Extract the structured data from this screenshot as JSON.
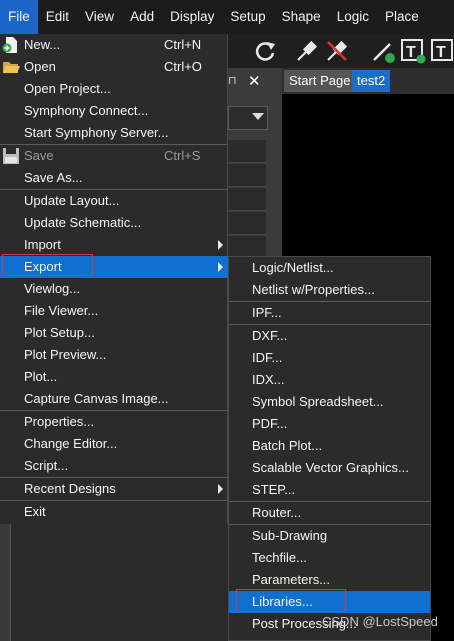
{
  "menubar": {
    "items": [
      "File",
      "Edit",
      "View",
      "Add",
      "Display",
      "Setup",
      "Shape",
      "Logic",
      "Place"
    ]
  },
  "tabs": {
    "start_page": "Start Page",
    "test2": "test2"
  },
  "dock": {
    "close_glyph": "✕",
    "pin_glyph": "⊓"
  },
  "file_menu": {
    "new": {
      "label": "New...",
      "shortcut": "Ctrl+N"
    },
    "open": {
      "label": "Open",
      "shortcut": "Ctrl+O"
    },
    "open_project": "Open Project...",
    "symphony_connect": "Symphony Connect...",
    "start_symphony_server": "Start Symphony Server...",
    "save": {
      "label": "Save",
      "shortcut": "Ctrl+S"
    },
    "save_as": "Save As...",
    "update_layout": "Update Layout...",
    "update_schematic": "Update Schematic...",
    "import": "Import",
    "export": "Export",
    "viewlog": "Viewlog...",
    "file_viewer": "File Viewer...",
    "plot_setup": "Plot Setup...",
    "plot_preview": "Plot Preview...",
    "plot": "Plot...",
    "capture_canvas_image": "Capture Canvas Image...",
    "properties": "Properties...",
    "change_editor": "Change Editor...",
    "script": "Script...",
    "recent_designs": "Recent Designs",
    "exit": "Exit"
  },
  "export_submenu": {
    "logic_netlist": "Logic/Netlist...",
    "netlist_wproperties": "Netlist w/Properties...",
    "ipf": "IPF...",
    "dxf": "DXF...",
    "idf": "IDF...",
    "idx": "IDX...",
    "symbol_spreadsheet": "Symbol Spreadsheet...",
    "pdf": "PDF...",
    "batch_plot": "Batch Plot...",
    "svg": "Scalable Vector Graphics...",
    "step": "STEP...",
    "router": "Router...",
    "sub_drawing": "Sub-Drawing",
    "techfile": "Techfile...",
    "parameters": "Parameters...",
    "libraries": "Libraries...",
    "post_processing": "Post Processing..."
  },
  "watermark": "CSDN @LostSpeed",
  "colors": {
    "highlight": "#1070d0",
    "menubar_active": "#1c66c8",
    "annotation_box": "#d43a3a",
    "tab_active": "#1a6dc8"
  }
}
